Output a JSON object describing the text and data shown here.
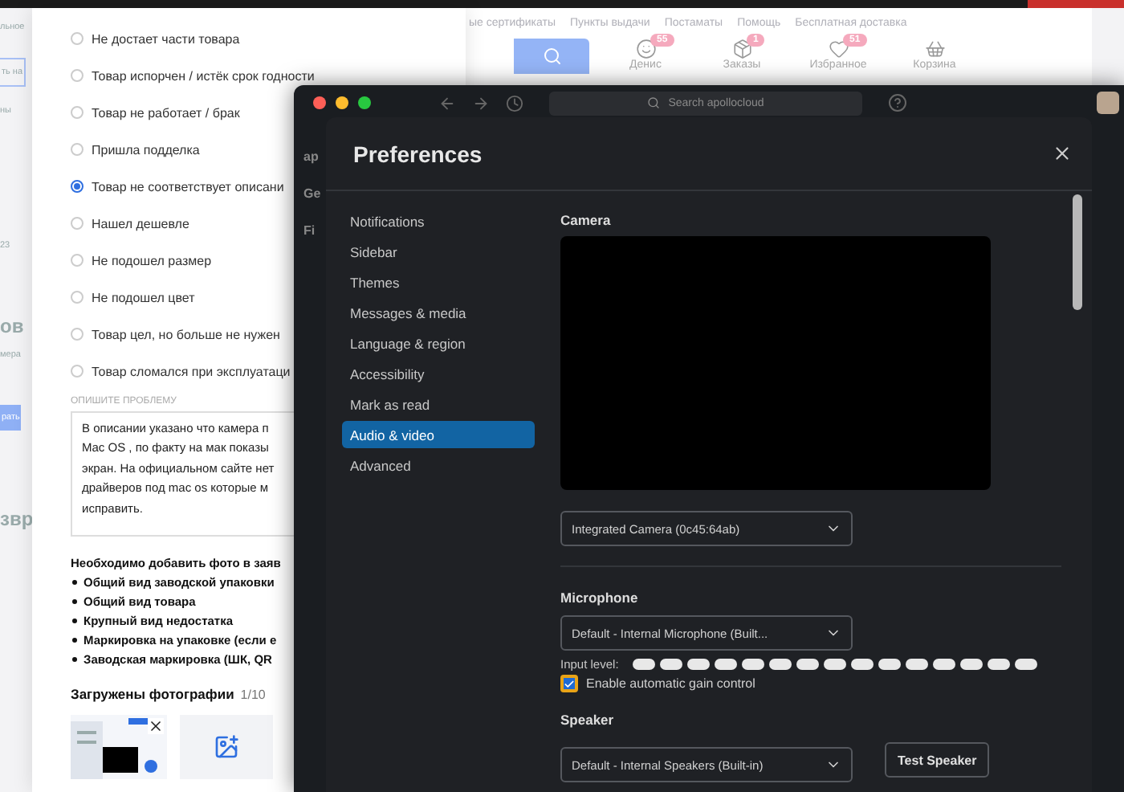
{
  "background_page": {
    "left_fragments": [
      {
        "kind": "text",
        "text": "льное"
      },
      {
        "kind": "field",
        "text": "ть на"
      },
      {
        "kind": "text",
        "text": "ны"
      },
      {
        "kind": "text",
        "text": "23"
      },
      {
        "kind": "heading",
        "text": "ов"
      },
      {
        "kind": "text",
        "text": "мера"
      },
      {
        "kind": "button",
        "text": "рать"
      },
      {
        "kind": "heading",
        "text": "звр"
      }
    ],
    "top_links": [
      "ые сертификаты",
      "Пункты выдачи",
      "Постаматы",
      "Помощь",
      "Бесплатная доставка"
    ],
    "header_actions": [
      {
        "label": "Денис",
        "badge": "55"
      },
      {
        "label": "Заказы",
        "badge": "1"
      },
      {
        "label": "Избранное",
        "badge": "51"
      },
      {
        "label": "Корзина"
      }
    ]
  },
  "return_form": {
    "reasons": [
      {
        "label": "Не достает части товара",
        "selected": false
      },
      {
        "label": "Товар испорчен / истёк срок годности",
        "selected": false
      },
      {
        "label": "Товар не работает / брак",
        "selected": false
      },
      {
        "label": "Пришла подделка",
        "selected": false
      },
      {
        "label": "Товар не соответствует описани",
        "selected": true
      },
      {
        "label": "Нашел дешевле",
        "selected": false
      },
      {
        "label": "Не подошел размер",
        "selected": false
      },
      {
        "label": "Не подошел цвет",
        "selected": false
      },
      {
        "label": "Товар цел, но больше не нужен",
        "selected": false
      },
      {
        "label": "Товар сломался при эксплуатаци",
        "selected": false
      }
    ],
    "problem_label": "ОПИШИТЕ ПРОБЛЕМУ",
    "problem_lines": [
      "В описании указано что камера п",
      "Mac OS , по факту на мак показы",
      "экран. На официальном сайте нет",
      "драйверов под mac os которые м",
      "исправить."
    ],
    "requirements_heading": "Необходимо добавить фото в заяв",
    "requirements": [
      "Общий вид заводской упаковки",
      "Общий вид товара",
      "Крупный вид недостатка",
      "Маркировка на упаковке (если е",
      "Заводская маркировка (ШК, QR"
    ],
    "uploads_title": "Загружены фотографии",
    "uploads_count": "1/10"
  },
  "slack": {
    "search": {
      "placeholder": "Search apollocloud"
    },
    "sidebar_fragments": [
      "ap",
      "Ge",
      "Fi"
    ],
    "preferences": {
      "title": "Preferences",
      "nav": [
        {
          "label": "Notifications",
          "selected": false
        },
        {
          "label": "Sidebar",
          "selected": false
        },
        {
          "label": "Themes",
          "selected": false
        },
        {
          "label": "Messages & media",
          "selected": false
        },
        {
          "label": "Language & region",
          "selected": false
        },
        {
          "label": "Accessibility",
          "selected": false
        },
        {
          "label": "Mark as read",
          "selected": false
        },
        {
          "label": "Audio & video",
          "selected": true
        },
        {
          "label": "Advanced",
          "selected": false
        }
      ],
      "camera": {
        "heading": "Camera",
        "device": "Integrated Camera (0c45:64ab)"
      },
      "microphone": {
        "heading": "Microphone",
        "device": "Default - Internal Microphone (Built...",
        "input_label": "Input level:",
        "auto_gain": {
          "label": "Enable automatic gain control",
          "checked": true
        }
      },
      "speaker": {
        "heading": "Speaker",
        "device": "Default - Internal Speakers (Built-in)",
        "test_button": "Test Speaker"
      }
    }
  }
}
